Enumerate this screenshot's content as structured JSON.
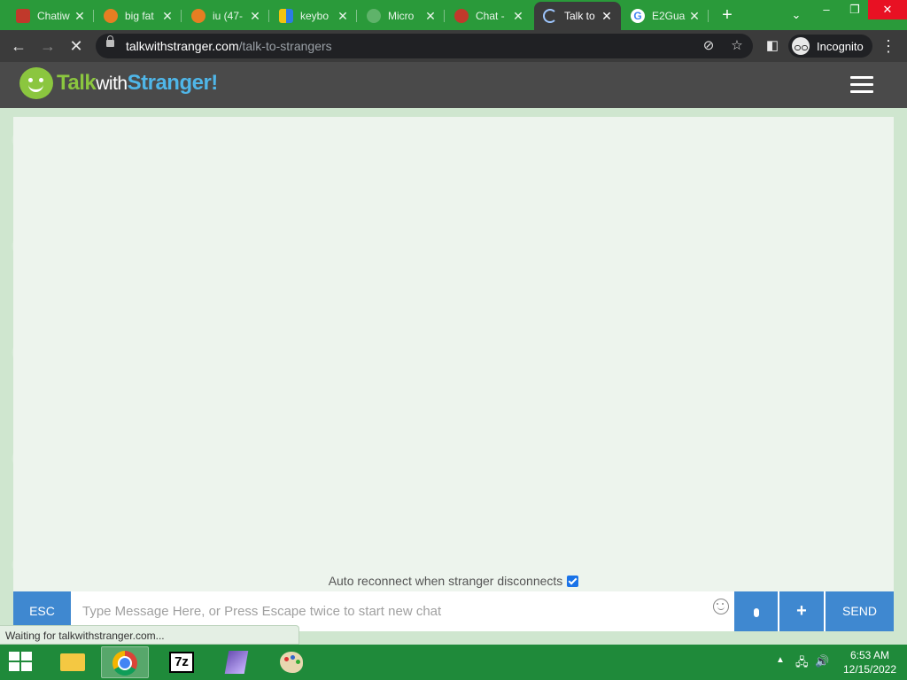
{
  "browser": {
    "tabs": [
      {
        "label": "Chatiw",
        "favicon_color": "#c0392b"
      },
      {
        "label": "big fat",
        "favicon_color": "#e67e22"
      },
      {
        "label": "iu (47-",
        "favicon_color": "#e67e22"
      },
      {
        "label": "keybo",
        "favicon_color": "#f1c40f"
      },
      {
        "label": "Micro",
        "favicon_color": "#2c7be5"
      },
      {
        "label": "Chat -",
        "favicon_color": "#c0392b"
      },
      {
        "label": "Talk to",
        "favicon_color": "#3b3b3b"
      },
      {
        "label": "E2Gua",
        "favicon_color": "#4285f4"
      }
    ],
    "url_domain": "talkwithstranger.com",
    "url_path": "/talk-to-strangers",
    "incognito_label": "Incognito",
    "status_text": "Waiting for talkwithstranger.com..."
  },
  "site": {
    "logo_part1": "Talk",
    "logo_part2": "with",
    "logo_part3": "Stranger!",
    "accent_green": "#8bc63f",
    "accent_blue": "#4fb6e8"
  },
  "chat": {
    "auto_reconnect_label": "Auto reconnect when stranger disconnects",
    "auto_reconnect_checked": true,
    "esc_label": "ESC",
    "message_placeholder": "Type Message Here, or Press Escape twice to start new chat",
    "plus_label": "+",
    "send_label": "SEND",
    "button_color": "#3f88d0"
  },
  "taskbar": {
    "time": "6:53 AM",
    "date": "12/15/2022"
  }
}
